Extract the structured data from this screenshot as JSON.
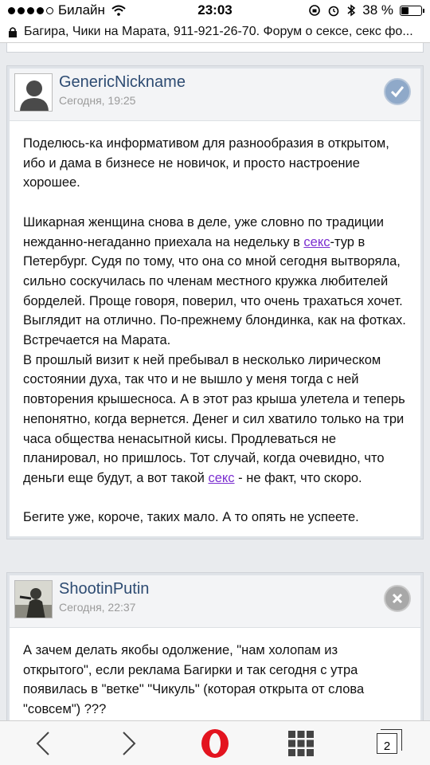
{
  "status": {
    "carrier": "Билайн",
    "time": "23:03",
    "battery": "38 %",
    "battery_fraction": 0.38
  },
  "urlbar": {
    "text": "Багира, Чики на Марата, 911-921-26-70. Форум о сексе, секс фо..."
  },
  "posts": [
    {
      "author": "GenericNickname",
      "date": "Сегодня, 19:25",
      "badge": "check-icon",
      "p1": "Поделюсь-ка информативом для разнообразия в открытом, ибо и дама в бизнесе не новичок, и просто настроение хорошее.",
      "p2_before": "Шикарная женщина снова в деле, уже словно по традиции нежданно-негаданно приехала на недельку в ",
      "p2_link": "секс",
      "p2_after": "-тур в Петербург. Судя по тому, что она со мной сегодня вытворяла, сильно соскучилась по членам местного кружка любителей борделей. Проще говоря, поверил, что очень трахаться хочет.",
      "p3": "Выглядит на отлично. По-прежнему блондинка, как на фотках. Встречается на Марата.",
      "p4_before": "В прошлый визит к ней пребывал в несколько лирическом состоянии духа, так что и не вышло у меня тогда с ней повторения крышесноса. А в этот раз крыша улетела и теперь непонятно, когда вернется. Денег и сил хватило только на три часа общества ненасытной кисы. Продлеваться не планировал, но пришлось. Тот случай, когда очевидно, что деньги еще будут, а вот такой ",
      "p4_link": "секс",
      "p4_after": " - не факт, что скоро.",
      "p5": "Бегите уже, короче, таких мало. А то опять не успеете."
    },
    {
      "author": "ShootinPutin",
      "date": "Сегодня, 22:37",
      "badge": "close-icon",
      "p1": "А зачем делать якобы одолжение, \"нам холопам из открытого\", если реклама Багирки и так сегодня с утра появилась в \"ветке\" \"Чикуль\" (которая открыта от слова \"совсем\") ???"
    }
  ],
  "toolbar": {
    "tabs_count": "2"
  }
}
